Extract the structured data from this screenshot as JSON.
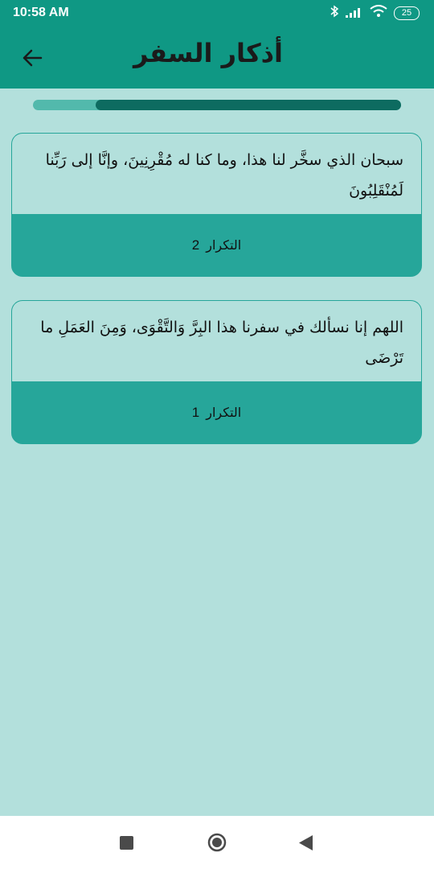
{
  "status_bar": {
    "time": "10:58 AM",
    "battery": "25",
    "icons": [
      "bluetooth-icon",
      "signal-icon",
      "wifi-icon",
      "battery-icon"
    ]
  },
  "app_bar": {
    "title": "أذكار السفر",
    "back_icon": "arrow-back-icon"
  },
  "progress": {
    "fraction": 0.83
  },
  "cards": [
    {
      "text": "سبحان الذي سخَّر لنا هذا، وما كنا له مُقْرِنِينَ، وإنَّا إلى رَبِّنا لَمُنْقَلِبُونَ",
      "counter_label": "التكرار",
      "count": "2"
    },
    {
      "text": "اللهم إنا نسألك في سفرنا هذا البِرَّ وَالتَّقْوَى، وَمِنَ العَمَلِ ما تَرْضَى",
      "counter_label": "التكرار",
      "count": "1"
    }
  ],
  "nav": {
    "items": [
      "recents-square-icon",
      "home-circle-icon",
      "back-triangle-icon"
    ]
  },
  "colors": {
    "primary": "#0f9884",
    "background": "#b3e0dc",
    "card_counter": "#26a69a",
    "progress_fill": "#0d6b60",
    "progress_track": "#52b9ac"
  }
}
